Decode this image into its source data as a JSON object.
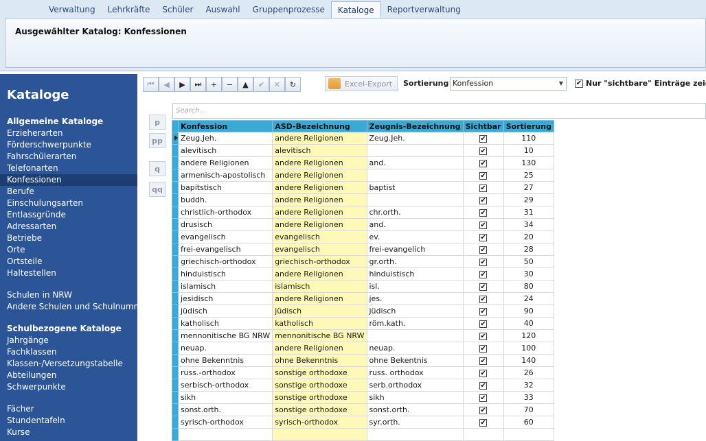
{
  "tabs": [
    "Verwaltung",
    "Lehrkräfte",
    "Schüler",
    "Auswahl",
    "Gruppenprozesse",
    "Kataloge",
    "Reportverwaltung"
  ],
  "active_tab": "Kataloge",
  "ribbon_title": "Ausgewählter Katalog: Konfessionen",
  "sidebar": {
    "title": "Kataloge",
    "items": [
      {
        "label": "Allgemeine Kataloge",
        "type": "head"
      },
      {
        "label": "Erzieherarten"
      },
      {
        "label": "Förderschwerpunkte"
      },
      {
        "label": "Fahrschülerarten"
      },
      {
        "label": "Telefonarten"
      },
      {
        "label": "Konfessionen",
        "selected": true
      },
      {
        "label": "Berufe"
      },
      {
        "label": "Einschulungsarten"
      },
      {
        "label": "Entlassgründe"
      },
      {
        "label": "Adressarten"
      },
      {
        "label": "Betriebe"
      },
      {
        "label": "Orte"
      },
      {
        "label": "Ortsteile"
      },
      {
        "label": "Haltestellen"
      },
      {
        "type": "gap"
      },
      {
        "label": "Schulen in NRW"
      },
      {
        "label": "Andere Schulen und Schulnummern"
      },
      {
        "type": "gap"
      },
      {
        "label": "Schulbezogene Kataloge",
        "type": "head"
      },
      {
        "label": "Jahrgänge"
      },
      {
        "label": "Fachklassen"
      },
      {
        "label": "Klassen-/Versetzungstabelle"
      },
      {
        "label": "Abteilungen"
      },
      {
        "label": "Schwerpunkte"
      },
      {
        "type": "gap"
      },
      {
        "label": "Fächer"
      },
      {
        "label": "Stundentafeln"
      },
      {
        "label": "Kurse"
      }
    ]
  },
  "toolbar": {
    "buttons": [
      {
        "name": "first-record-button",
        "glyph": "⏮",
        "disabled": true
      },
      {
        "name": "prev-record-button",
        "glyph": "◀",
        "disabled": true
      },
      {
        "name": "next-record-button",
        "glyph": "▶",
        "disabled": false
      },
      {
        "name": "last-record-button",
        "glyph": "⏭",
        "disabled": false
      },
      {
        "name": "add-record-button",
        "glyph": "+",
        "disabled": false
      },
      {
        "name": "delete-record-button",
        "glyph": "−",
        "disabled": false
      },
      {
        "name": "move-up-button",
        "glyph": "▲",
        "disabled": false
      },
      {
        "name": "confirm-button",
        "glyph": "✔",
        "disabled": true
      },
      {
        "name": "cancel-edit-button",
        "glyph": "✕",
        "disabled": true
      },
      {
        "name": "refresh-button",
        "glyph": "↻",
        "disabled": false
      }
    ],
    "excel_export": "Excel-Export",
    "sort_label": "Sortierung",
    "sort_value": "Konfession",
    "visible_only_label": "Nur \"sichtbare\" Einträge zeigen",
    "visible_only_checked": true
  },
  "search_placeholder": "Search...",
  "side_buttons": [
    "p",
    "pp",
    "q",
    "qq"
  ],
  "grid": {
    "columns": [
      "Konfession",
      "ASD-Bezeichnung",
      "Zeugnis-Bezeichnung",
      "Sichtbar",
      "Sortierung"
    ],
    "rows": [
      [
        "Zeug.Jeh.",
        "andere Religionen",
        "Zeug.Jeh.",
        true,
        "110"
      ],
      [
        "alevitisch",
        "alevitisch",
        "",
        true,
        "10"
      ],
      [
        "andere Religionen",
        "andere Religionen",
        "and.",
        true,
        "130"
      ],
      [
        "armenisch-apostolisch",
        "andere Religionen",
        "",
        true,
        "25"
      ],
      [
        "bapitstisch",
        "andere Religionen",
        "baptist",
        true,
        "27"
      ],
      [
        "buddh.",
        "andere Religionen",
        "",
        true,
        "29"
      ],
      [
        "christlich-orthodox",
        "andere Religionen",
        "chr.orth.",
        true,
        "31"
      ],
      [
        "drusisch",
        "andere Religionen",
        "and.",
        true,
        "34"
      ],
      [
        "evangelisch",
        "evangelisch",
        "ev.",
        true,
        "20"
      ],
      [
        "frei-evangelisch",
        "evangelisch",
        "frei-evangelich",
        true,
        "28"
      ],
      [
        "griechisch-orthodox",
        "griechisch-orthodox",
        "gr.orth.",
        true,
        "50"
      ],
      [
        "hinduistisch",
        "andere Religionen",
        "hinduistisch",
        true,
        "30"
      ],
      [
        "islamisch",
        "islamisch",
        "isl.",
        true,
        "80"
      ],
      [
        "jesidisch",
        "andere Religionen",
        "jes.",
        true,
        "24"
      ],
      [
        "jüdisch",
        "jüdisch",
        "jüdisch",
        true,
        "90"
      ],
      [
        "katholisch",
        "katholisch",
        "röm.kath.",
        true,
        "40"
      ],
      [
        "mennonitische BG NRW",
        "mennonitische BG NRW",
        "",
        true,
        "120"
      ],
      [
        "neuap.",
        "andere Religionen",
        "neuap.",
        true,
        "100"
      ],
      [
        "ohne Bekenntnis",
        "ohne Bekenntnis",
        "ohne Bekentnis",
        true,
        "140"
      ],
      [
        "russ.-orthodox",
        "sonstige orthodoxe",
        "russ. orthodox",
        true,
        "26"
      ],
      [
        "serbisch-orthodox",
        "sonstige orthodoxe",
        "serb.orthodox",
        true,
        "32"
      ],
      [
        "sikh",
        "sonstige orthodoxe",
        "sikh",
        true,
        "33"
      ],
      [
        "sonst.orth.",
        "sonstige orthodoxe",
        "sonst.orth.",
        true,
        "70"
      ],
      [
        "syrisch-orthodox",
        "syrisch-orthodox",
        "syr.orth.",
        true,
        "60"
      ]
    ]
  }
}
